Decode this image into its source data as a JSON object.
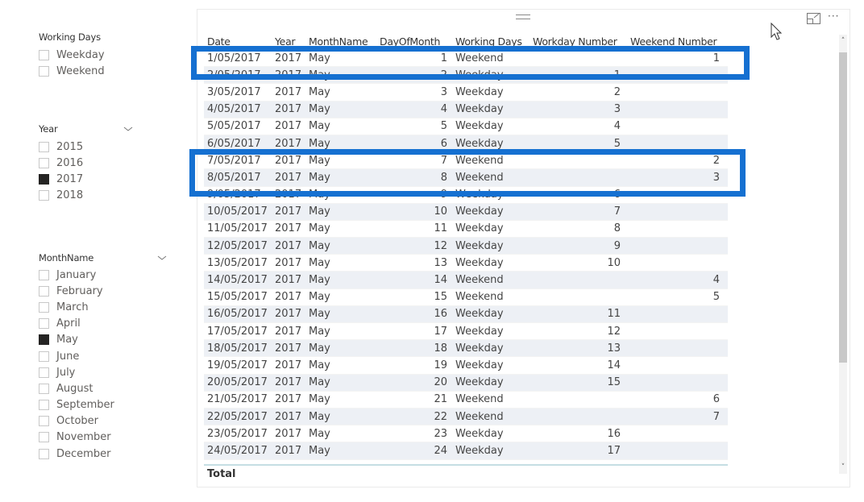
{
  "slicers": {
    "working_days": {
      "title": "Working Days",
      "items": [
        {
          "label": "Weekday",
          "checked": false
        },
        {
          "label": "Weekend",
          "checked": false
        }
      ]
    },
    "year": {
      "title": "Year",
      "items": [
        {
          "label": "2015",
          "checked": false
        },
        {
          "label": "2016",
          "checked": false
        },
        {
          "label": "2017",
          "checked": true
        },
        {
          "label": "2018",
          "checked": false
        }
      ]
    },
    "month": {
      "title": "MonthName",
      "items": [
        {
          "label": "January",
          "checked": false
        },
        {
          "label": "February",
          "checked": false
        },
        {
          "label": "March",
          "checked": false
        },
        {
          "label": "April",
          "checked": false
        },
        {
          "label": "May",
          "checked": true
        },
        {
          "label": "June",
          "checked": false
        },
        {
          "label": "July",
          "checked": false
        },
        {
          "label": "August",
          "checked": false
        },
        {
          "label": "September",
          "checked": false
        },
        {
          "label": "October",
          "checked": false
        },
        {
          "label": "November",
          "checked": false
        },
        {
          "label": "December",
          "checked": false
        }
      ]
    }
  },
  "table": {
    "columns": [
      "Date",
      "Year",
      "MonthName",
      "DayOfMonth",
      "Working Days",
      "Workday Number",
      "Weekend Number"
    ],
    "rows": [
      [
        "1/05/2017",
        "2017",
        "May",
        "1",
        "Weekend",
        "",
        "1"
      ],
      [
        "2/05/2017",
        "2017",
        "May",
        "2",
        "Weekday",
        "1",
        ""
      ],
      [
        "3/05/2017",
        "2017",
        "May",
        "3",
        "Weekday",
        "2",
        ""
      ],
      [
        "4/05/2017",
        "2017",
        "May",
        "4",
        "Weekday",
        "3",
        ""
      ],
      [
        "5/05/2017",
        "2017",
        "May",
        "5",
        "Weekday",
        "4",
        ""
      ],
      [
        "6/05/2017",
        "2017",
        "May",
        "6",
        "Weekday",
        "5",
        ""
      ],
      [
        "7/05/2017",
        "2017",
        "May",
        "7",
        "Weekend",
        "",
        "2"
      ],
      [
        "8/05/2017",
        "2017",
        "May",
        "8",
        "Weekend",
        "",
        "3"
      ],
      [
        "9/05/2017",
        "2017",
        "May",
        "9",
        "Weekday",
        "6",
        ""
      ],
      [
        "10/05/2017",
        "2017",
        "May",
        "10",
        "Weekday",
        "7",
        ""
      ],
      [
        "11/05/2017",
        "2017",
        "May",
        "11",
        "Weekday",
        "8",
        ""
      ],
      [
        "12/05/2017",
        "2017",
        "May",
        "12",
        "Weekday",
        "9",
        ""
      ],
      [
        "13/05/2017",
        "2017",
        "May",
        "13",
        "Weekday",
        "10",
        ""
      ],
      [
        "14/05/2017",
        "2017",
        "May",
        "14",
        "Weekend",
        "",
        "4"
      ],
      [
        "15/05/2017",
        "2017",
        "May",
        "15",
        "Weekend",
        "",
        "5"
      ],
      [
        "16/05/2017",
        "2017",
        "May",
        "16",
        "Weekday",
        "11",
        ""
      ],
      [
        "17/05/2017",
        "2017",
        "May",
        "17",
        "Weekday",
        "12",
        ""
      ],
      [
        "18/05/2017",
        "2017",
        "May",
        "18",
        "Weekday",
        "13",
        ""
      ],
      [
        "19/05/2017",
        "2017",
        "May",
        "19",
        "Weekday",
        "14",
        ""
      ],
      [
        "20/05/2017",
        "2017",
        "May",
        "20",
        "Weekday",
        "15",
        ""
      ],
      [
        "21/05/2017",
        "2017",
        "May",
        "21",
        "Weekend",
        "",
        "6"
      ],
      [
        "22/05/2017",
        "2017",
        "May",
        "22",
        "Weekend",
        "",
        "7"
      ],
      [
        "23/05/2017",
        "2017",
        "May",
        "23",
        "Weekday",
        "16",
        ""
      ],
      [
        "24/05/2017",
        "2017",
        "May",
        "24",
        "Weekday",
        "17",
        ""
      ]
    ],
    "total_label": "Total"
  },
  "icons": {
    "more_options": "···",
    "scroll_up": "˄",
    "scroll_down": "˅"
  },
  "colors": {
    "highlight": "#1570d1",
    "row_alt": "#edf0f5",
    "checked": "#252423"
  }
}
